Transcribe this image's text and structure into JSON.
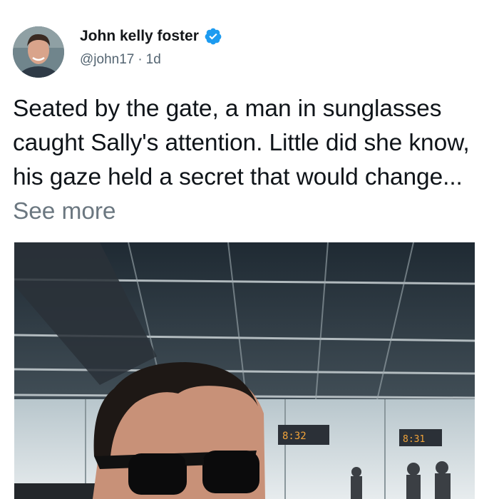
{
  "post": {
    "author_name": "John kelly foster",
    "handle": "@john17",
    "separator": "·",
    "time": "1d",
    "text": "Seated by the gate, a man in sunglasses caught Sally's attention. Little did she know, his gaze held a secret that would change...",
    "see_more": "See more"
  },
  "image": {
    "board_left_text": "8:32",
    "board_right_text": "8:31"
  },
  "colors": {
    "verified": "#1d9bf0",
    "meta_text": "#536471",
    "see_more": "#6b7780"
  },
  "icons": {
    "verified": "verified-badge-icon"
  }
}
